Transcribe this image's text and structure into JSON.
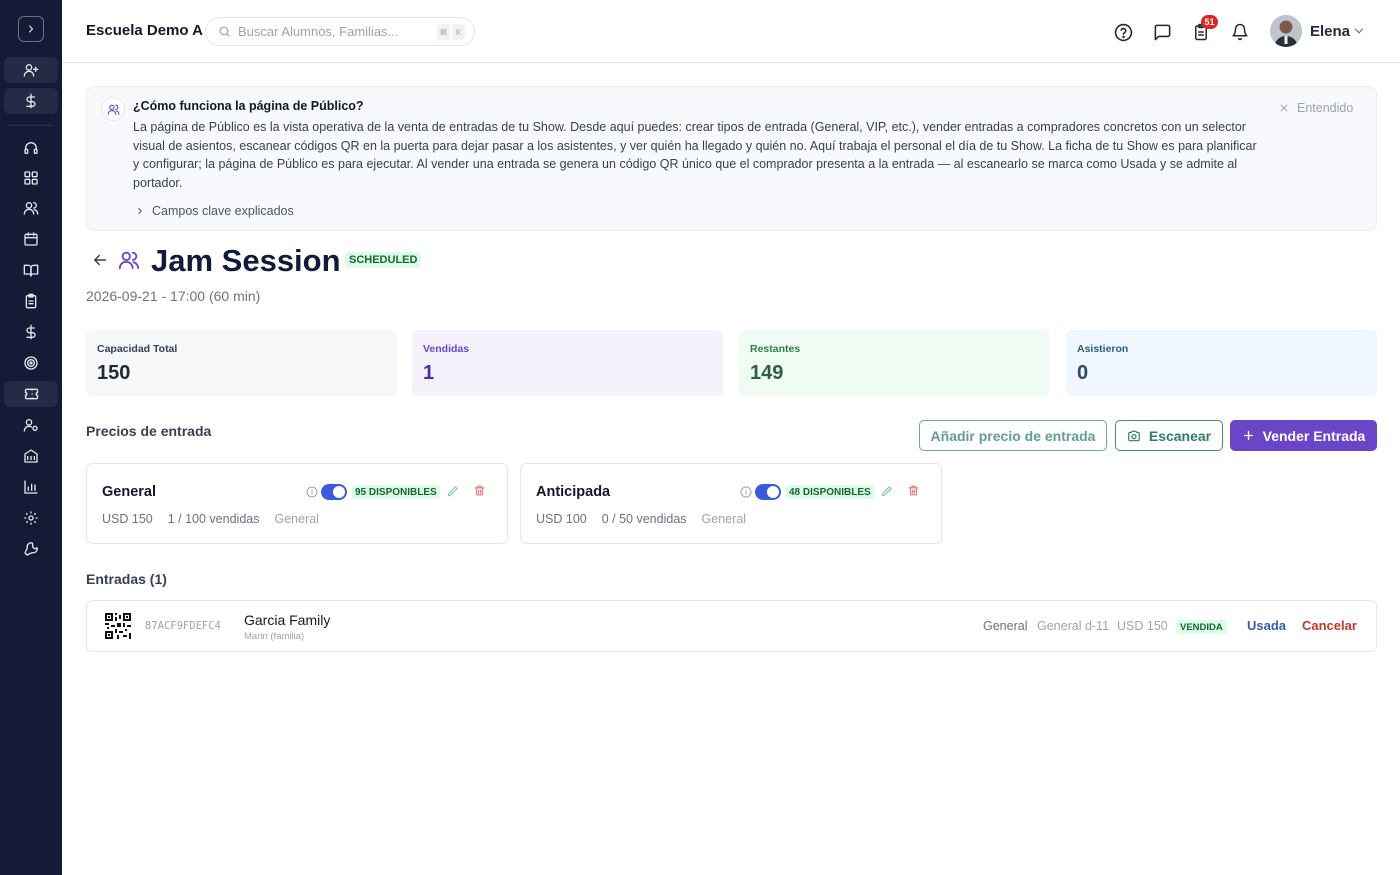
{
  "header": {
    "school_name": "Escuela Demo A",
    "search_placeholder": "Buscar Alumnos, Familias...",
    "search_shortcut": [
      "⌘",
      "K"
    ],
    "notifications_count": "51",
    "user_name": "Elena"
  },
  "info": {
    "title": "¿Cómo funciona la página de Público?",
    "body": "La página de Público es la vista operativa de la venta de entradas de tu Show. Desde aquí puedes: crear tipos de entrada (General, VIP, etc.), vender entradas a compradores concretos con un selector visual de asientos, escanear códigos QR en la puerta para dejar pasar a los asistentes, y ver quién ha llegado y quién no. Aquí trabaja el personal el día de tu Show. La ficha de tu Show es para planificar y configurar; la página de Público es para ejecutar. Al vender una entrada se genera un código QR único que el comprador presenta a la entrada — al escanearlo se marca como Usada y se admite al portador.",
    "dismiss_label": "Entendido",
    "expand_label": "Campos clave explicados"
  },
  "event": {
    "title": "Jam Session",
    "status": "SCHEDULED",
    "datetime": "2026-09-21 - 17:00 (60 min)"
  },
  "stats": [
    {
      "label": "Capacidad Total",
      "value": "150"
    },
    {
      "label": "Vendidas",
      "value": "1"
    },
    {
      "label": "Restantes",
      "value": "149"
    },
    {
      "label": "Asistieron",
      "value": "0"
    }
  ],
  "prices_section": {
    "heading": "Precios de entrada",
    "add_price_label": "Añadir precio de entrada",
    "scan_label": "Escanear",
    "sell_label": "Vender Entrada"
  },
  "price_cards": [
    {
      "name": "General",
      "available": "95 DISPONIBLES",
      "price": "USD 150",
      "sold": "1 / 100 vendidas",
      "category": "General",
      "enabled": true
    },
    {
      "name": "Anticipada",
      "available": "48 DISPONIBLES",
      "price": "USD 100",
      "sold": "0 / 50 vendidas",
      "category": "General",
      "enabled": true
    }
  ],
  "tickets_section": {
    "heading": "Entradas (1)"
  },
  "tickets": [
    {
      "code": "87ACF9FDEFC4",
      "buyer": "Garcia Family",
      "buyer_sub": "Marin (familia)",
      "price_type": "General",
      "seat": "General d-11",
      "price": "USD 150",
      "status": "VENDIDA",
      "use_label": "Usada",
      "cancel_label": "Cancelar"
    }
  ],
  "colors": {
    "sidebar_bg": "#161a36",
    "accent_purple": "#6a45c8",
    "accent_teal": "#2f7d6c",
    "badge_red": "#dc2626",
    "status_green_bg": "#dcfce7",
    "status_green_text": "#166534"
  }
}
